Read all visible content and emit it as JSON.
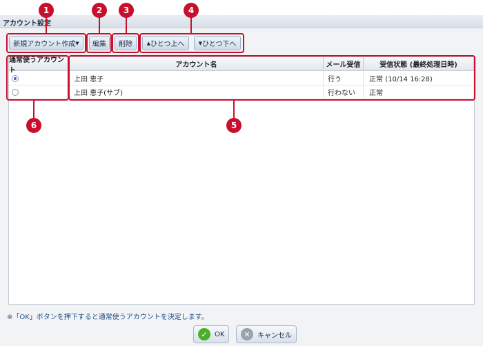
{
  "dialog": {
    "title": "アカウント設定"
  },
  "toolbar": {
    "new_account": "新規アカウント作成",
    "edit": "編集",
    "delete": "削除",
    "move_up": "ひとつ上へ",
    "move_down": "ひとつ下へ"
  },
  "callouts": [
    "1",
    "2",
    "3",
    "4",
    "5",
    "6"
  ],
  "table": {
    "headers": [
      "通常使うアカウント",
      "アカウント名",
      "メール受信",
      "受信状態 (最終処理日時)"
    ],
    "rows": [
      {
        "default": true,
        "account_name": "上田 恵子",
        "mail_receive": "行う",
        "status": "正常 (10/14 16:28)"
      },
      {
        "default": false,
        "account_name": "上田 恵子(サブ)",
        "mail_receive": "行わない",
        "status": "正常"
      }
    ]
  },
  "note": "※「OK」ボタンを押下すると通常使うアカウントを決定します。",
  "buttons": {
    "ok": "OK",
    "cancel": "キャンセル"
  },
  "colors": {
    "callout": "#c8102e",
    "ok_icon": "#4caf2a",
    "cancel_icon": "#9aa3ad"
  }
}
